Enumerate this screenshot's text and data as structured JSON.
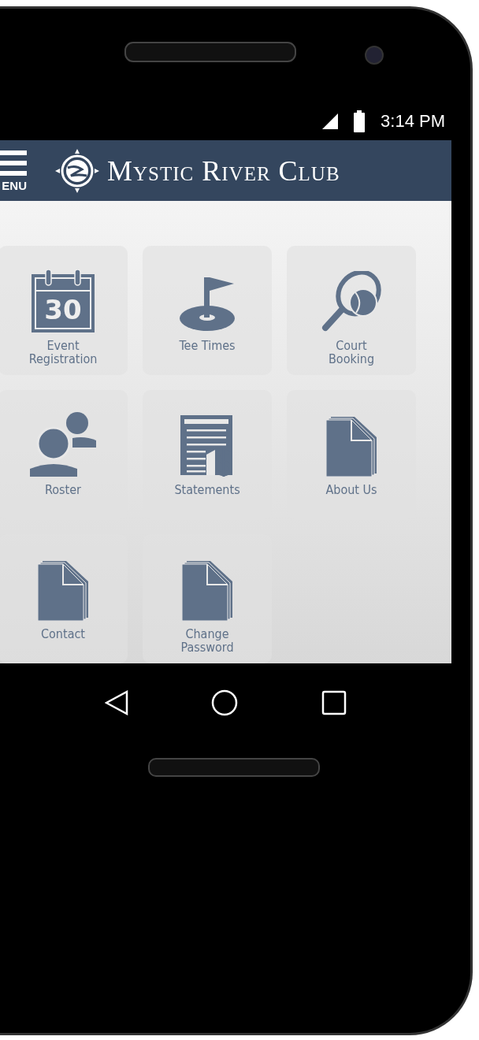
{
  "status_bar": {
    "time": "3:14 PM"
  },
  "header": {
    "menu_label": "ENU",
    "title": "Mystic River Club"
  },
  "tiles": [
    {
      "kind": "calendar",
      "label": "Event\nRegistration",
      "calendar_day": "30"
    },
    {
      "kind": "flag",
      "label": "Tee Times"
    },
    {
      "kind": "racket",
      "label": "Court\nBooking"
    },
    {
      "kind": "people",
      "label": "Roster"
    },
    {
      "kind": "statement",
      "label": "Statements"
    },
    {
      "kind": "document",
      "label": "About Us"
    },
    {
      "kind": "document",
      "label": "Contact"
    },
    {
      "kind": "document",
      "label": "Change\nPassword"
    }
  ]
}
